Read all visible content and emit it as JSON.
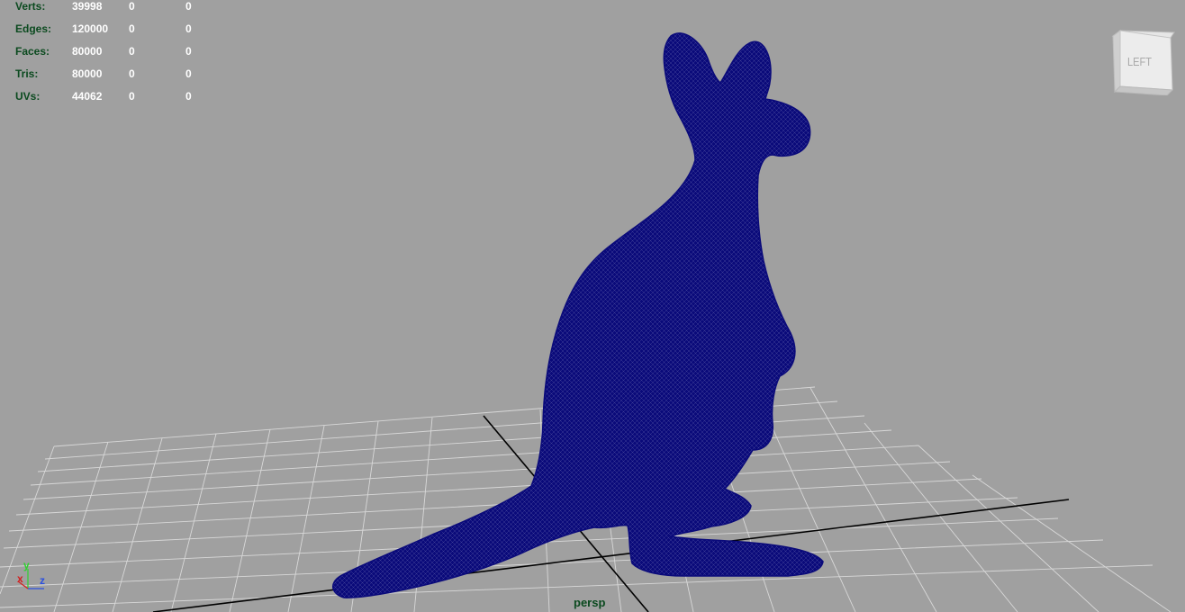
{
  "hud": {
    "rows": [
      {
        "label": "Verts:",
        "c1": "39998",
        "c2": "0",
        "c3": "0"
      },
      {
        "label": "Edges:",
        "c1": "120000",
        "c2": "0",
        "c3": "0"
      },
      {
        "label": "Faces:",
        "c1": "80000",
        "c2": "0",
        "c3": "0"
      },
      {
        "label": "Tris:",
        "c1": "80000",
        "c2": "0",
        "c3": "0"
      },
      {
        "label": "UVs:",
        "c1": "44062",
        "c2": "0",
        "c3": "0"
      }
    ]
  },
  "viewport": {
    "camera_name": "persp",
    "background_color": "#a0a0a0",
    "grid_color": "#d8d8d8",
    "axis_line_color": "#000000",
    "wireframe_color": "#0a0a7a",
    "hud_label_color": "#0b4a1f"
  },
  "viewcube": {
    "face_label": "LEFT"
  },
  "axis_gizmo": {
    "x_label": "x",
    "y_label": "y",
    "z_label": "z",
    "x_color": "#d21f1f",
    "y_color": "#2ed02e",
    "z_color": "#2a4fe0"
  },
  "model": {
    "icon": "kangaroo-mesh"
  }
}
